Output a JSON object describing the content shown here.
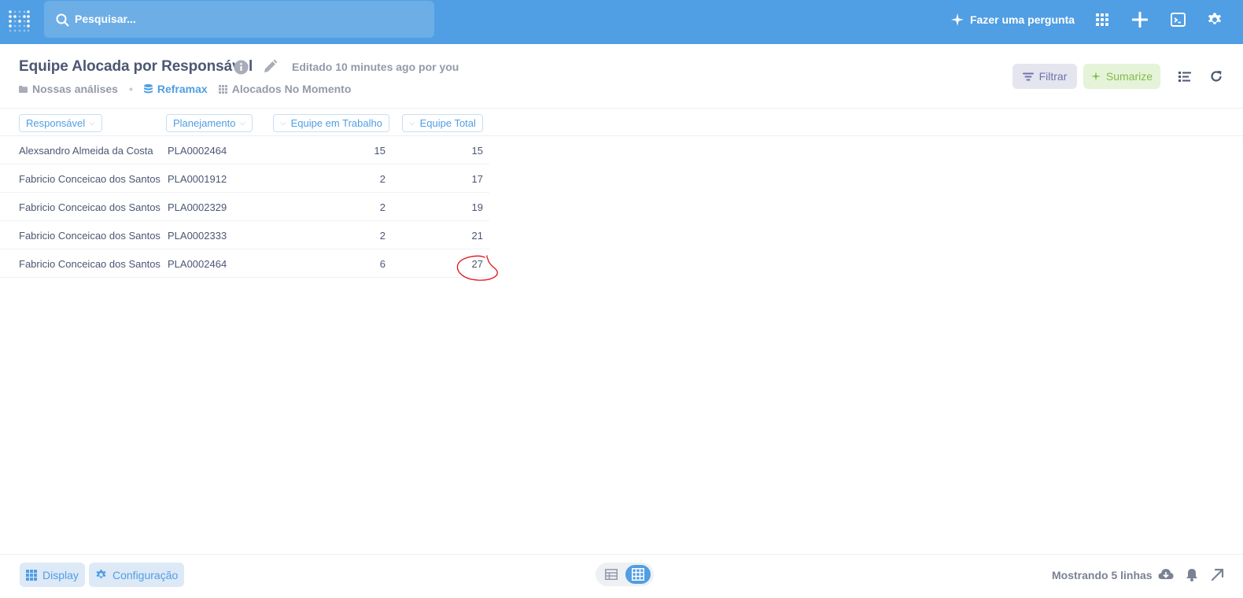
{
  "topnav": {
    "search_placeholder": "Pesquisar...",
    "ask_label": "Fazer uma pergunta",
    "icons": [
      "logo-icon",
      "search-icon",
      "sparkle-icon",
      "grid-icon",
      "plus-icon",
      "terminal-icon",
      "gear-icon"
    ],
    "bar_color": "#509ee3"
  },
  "header": {
    "title": "Equipe Alocada por Responsável",
    "edited": "Editado 10 minutes ago por you",
    "breadcrumbs": {
      "collection": "Nossas análises",
      "database": "Reframax",
      "table": "Alocados No Momento"
    },
    "filter_label": "Filtrar",
    "summarize_label": "Sumarize"
  },
  "table": {
    "columns": [
      "Responsável",
      "Planejamento",
      "Equipe em Trabalho",
      "Equipe Total"
    ],
    "rows": [
      [
        "Alexsandro Almeida da Costa",
        "PLA0002464",
        "15",
        "15"
      ],
      [
        "Fabricio Conceicao dos Santos",
        "PLA0001912",
        "2",
        "17"
      ],
      [
        "Fabricio Conceicao dos Santos",
        "PLA0002329",
        "2",
        "19"
      ],
      [
        "Fabricio Conceicao dos Santos",
        "PLA0002333",
        "2",
        "21"
      ],
      [
        "Fabricio Conceicao dos Santos",
        "PLA0002464",
        "6",
        "27"
      ]
    ],
    "highlight_color": "#e0101a"
  },
  "footer": {
    "display_label": "Display",
    "config_label": "Configuração",
    "row_count": "Mostrando 5 linhas"
  }
}
